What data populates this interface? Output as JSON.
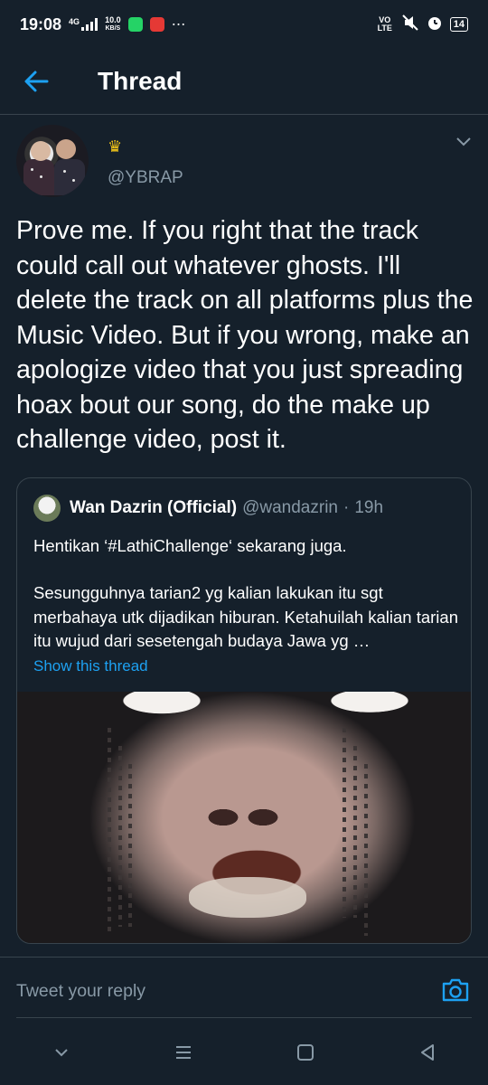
{
  "status_bar": {
    "time": "19:08",
    "network": "4G",
    "speed_value": "10.0",
    "speed_unit": "KB/S",
    "volte": "VO LTE",
    "battery": "14"
  },
  "header": {
    "title": "Thread",
    "back_icon": "arrow-left-icon"
  },
  "tweet": {
    "badge_icon": "crown-icon",
    "handle": "@YBRAP",
    "text": "Prove me. If you right that the track could call out whatever ghosts. I'll delete the track on all platforms plus the Music Video. But if you wrong, make an apologize video that you just spreading hoax bout our song, do the make up challenge video, post it."
  },
  "quoted_tweet": {
    "name": "Wan Dazrin (Official)",
    "handle": "@wandazrin",
    "separator": "·",
    "time": "19h",
    "line1": "Hentikan ‘#LathiChallenge‘ sekarang juga.",
    "paragraph": "Sesungguhnya tarian2 yg kalian lakukan itu sgt merbahaya utk dijadikan hiburan. Ketahuilah kalian tarian itu wujud dari sesetengah budaya Jawa yg …",
    "link": "Show this thread"
  },
  "reply": {
    "placeholder": "Tweet your reply",
    "camera_icon": "camera-icon"
  },
  "colors": {
    "background": "#15202b",
    "accent": "#1da1f2",
    "secondary_text": "#8899a6",
    "divider": "#38444d"
  }
}
